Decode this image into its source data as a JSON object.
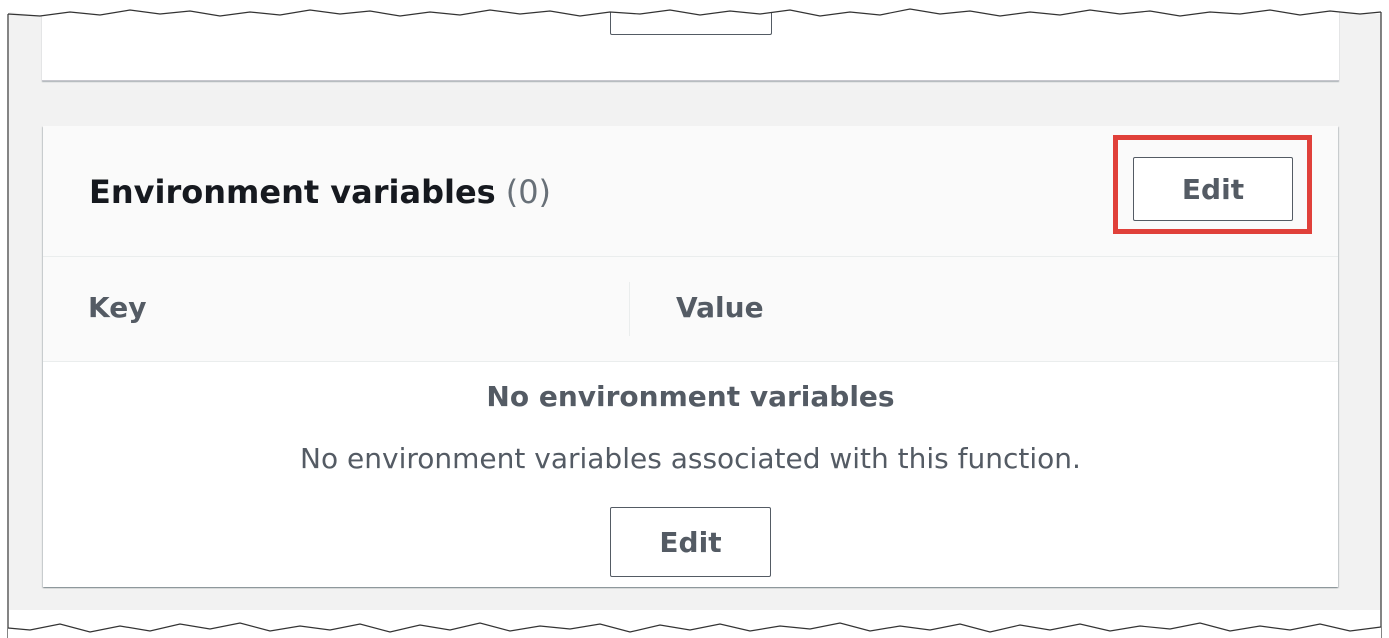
{
  "section": {
    "title": "Environment variables",
    "count": "(0)",
    "edit_button_label": "Edit"
  },
  "table": {
    "columns": [
      "Key",
      "Value"
    ]
  },
  "empty_state": {
    "title": "No environment variables",
    "description": "No environment variables associated with this function.",
    "edit_button_label": "Edit"
  },
  "colors": {
    "highlight": "#e0403a",
    "page_background": "#f2f2f2",
    "text_primary": "#16191f",
    "text_secondary": "#545b64"
  }
}
